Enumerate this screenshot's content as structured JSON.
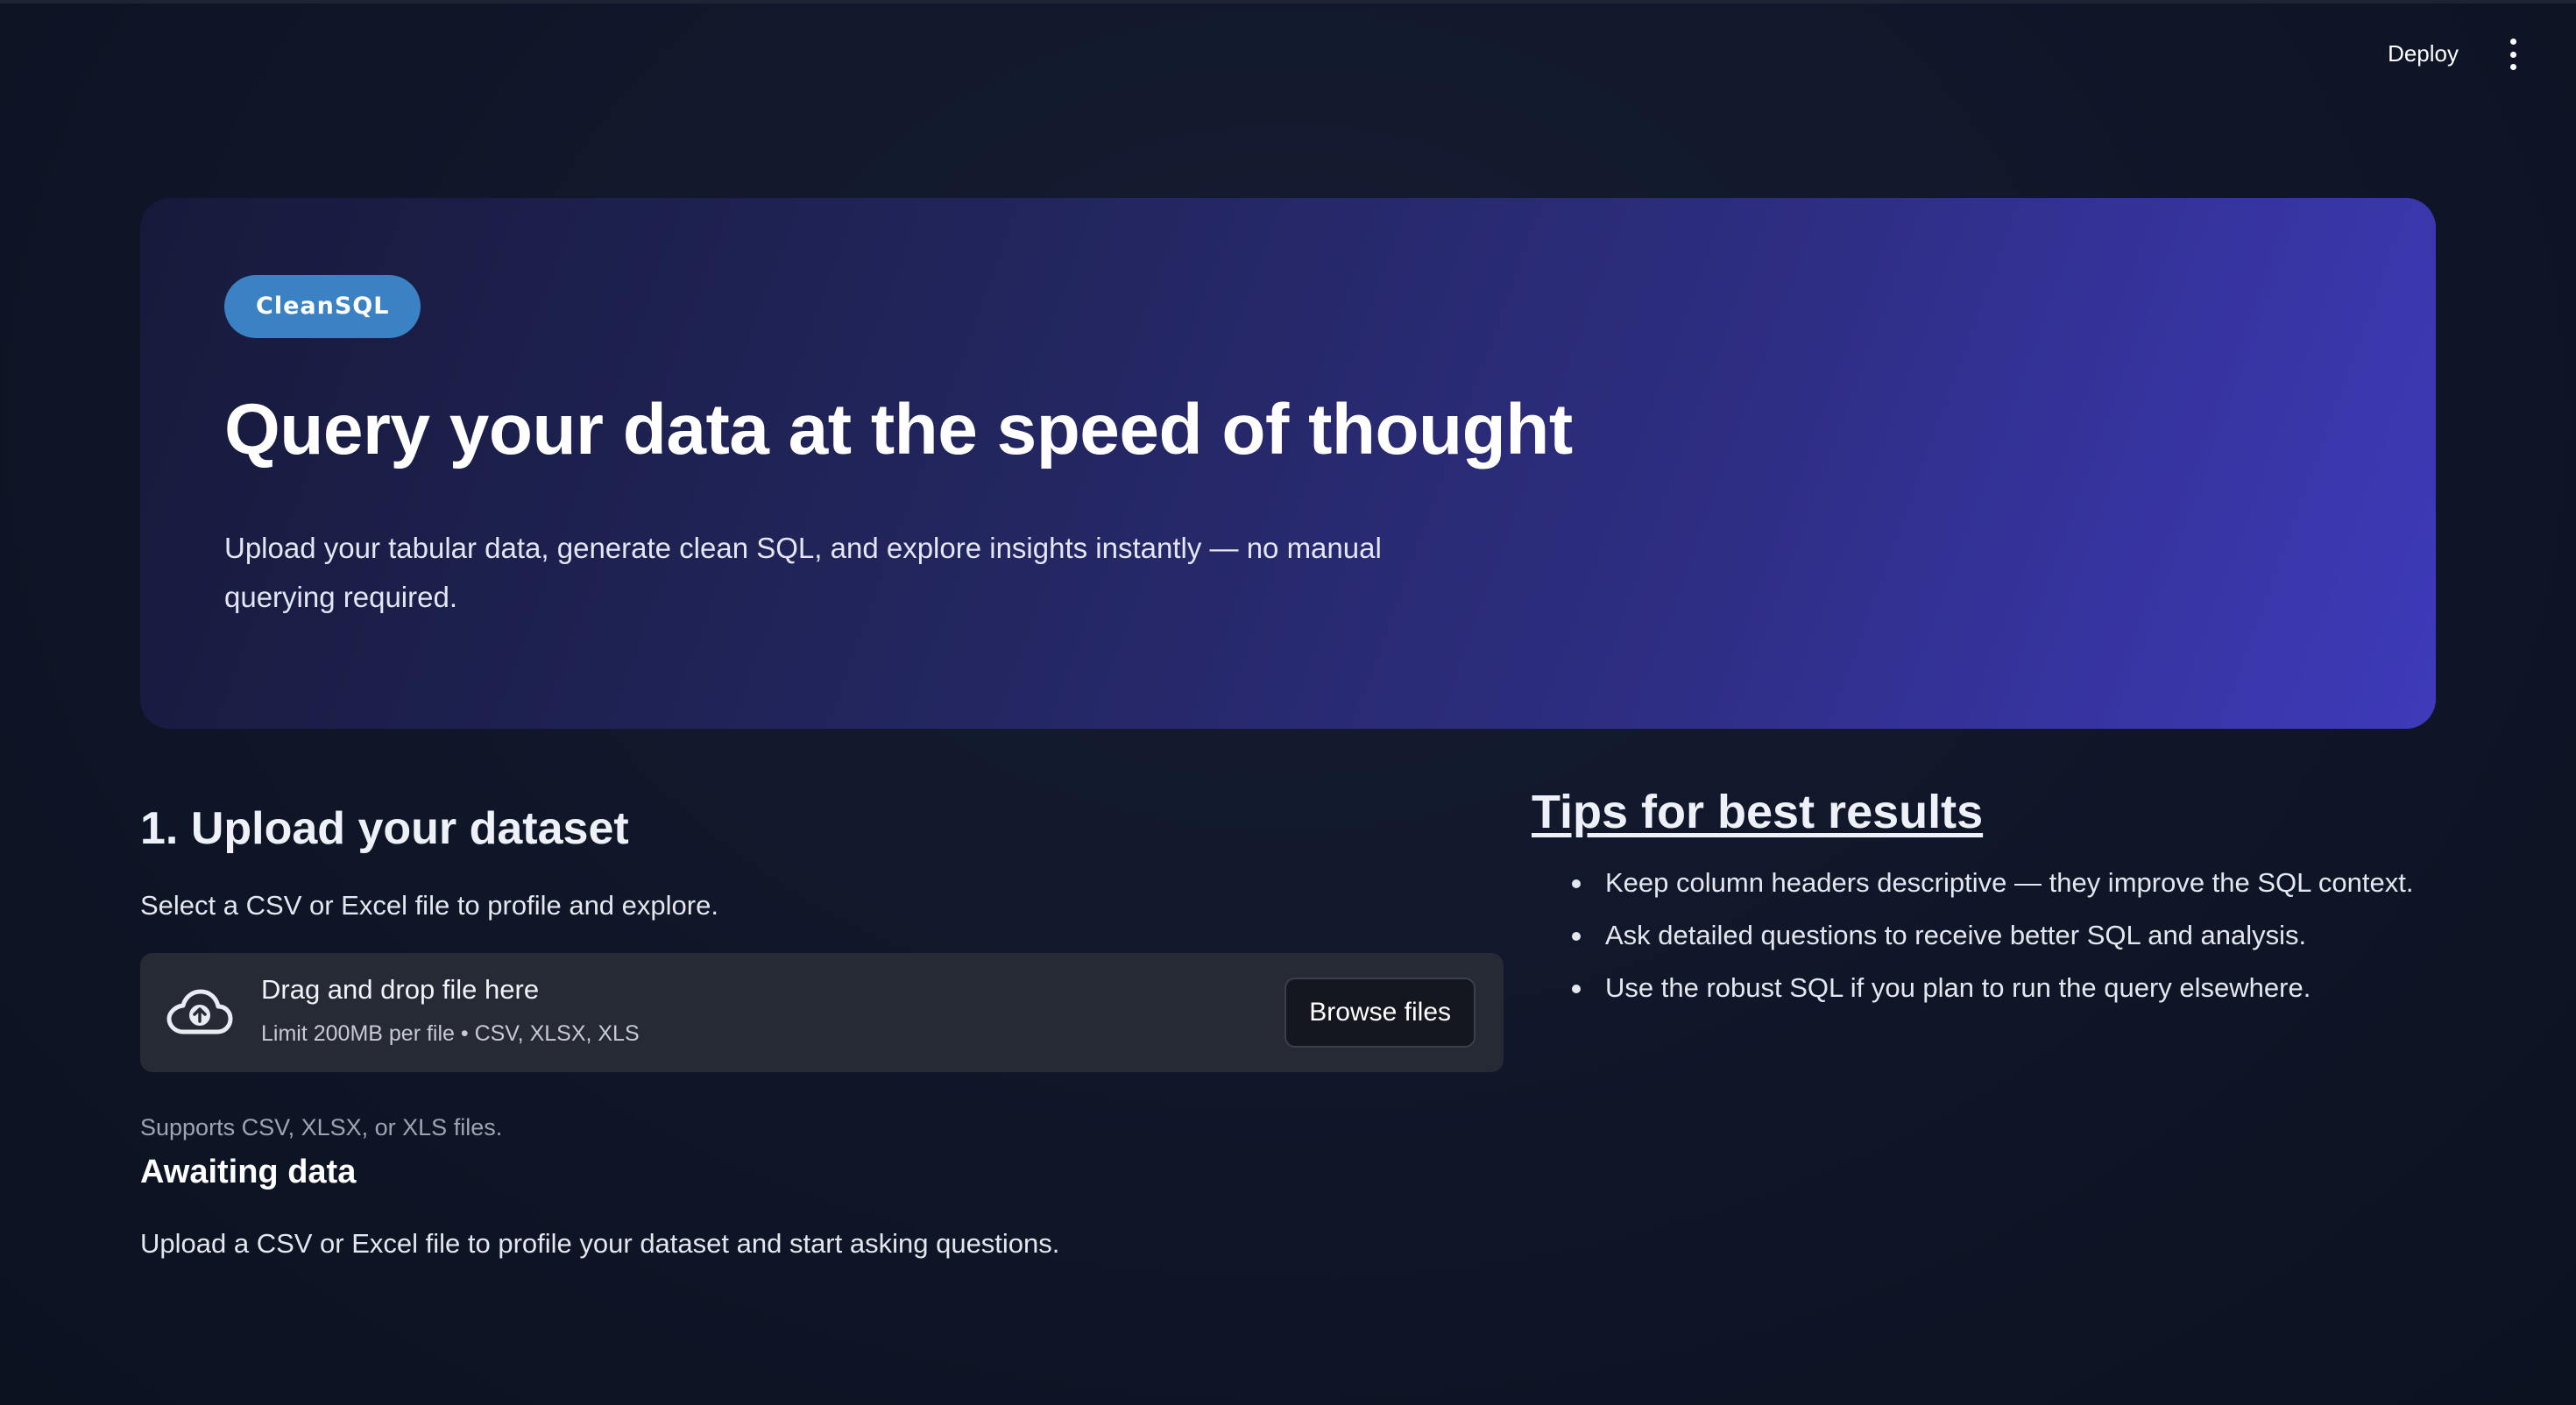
{
  "header": {
    "deploy_label": "Deploy",
    "menu_icon": "kebab-menu-icon"
  },
  "hero": {
    "badge": "CleanSQL",
    "title": "Query your data at the speed of thought",
    "subtitle": "Upload your tabular data, generate clean SQL, and explore insights instantly — no manual querying required."
  },
  "upload": {
    "title": "1. Upload your dataset",
    "description": "Select a CSV or Excel file to profile and explore.",
    "dropzone": {
      "icon": "cloud-upload-icon",
      "title": "Drag and drop file here",
      "limit": "Limit 200MB per file • CSV, XLSX, XLS",
      "browse_label": "Browse files"
    },
    "helper": "Supports CSV, XLSX, or XLS files.",
    "status_title": "Awaiting data",
    "status_desc": "Upload a CSV or Excel file to profile your dataset and start asking questions."
  },
  "tips": {
    "title": "Tips for best results",
    "items": [
      "Keep column headers descriptive — they improve the SQL context.",
      "Ask detailed questions to receive better SQL and analysis.",
      "Use the robust SQL if you plan to run the query elsewhere."
    ]
  },
  "colors": {
    "badge": "#3b82c4",
    "hero_gradient_start": "#161a3a",
    "hero_gradient_end": "#3e3aba",
    "background": "#0f1628",
    "dropzone": "#262a35"
  }
}
